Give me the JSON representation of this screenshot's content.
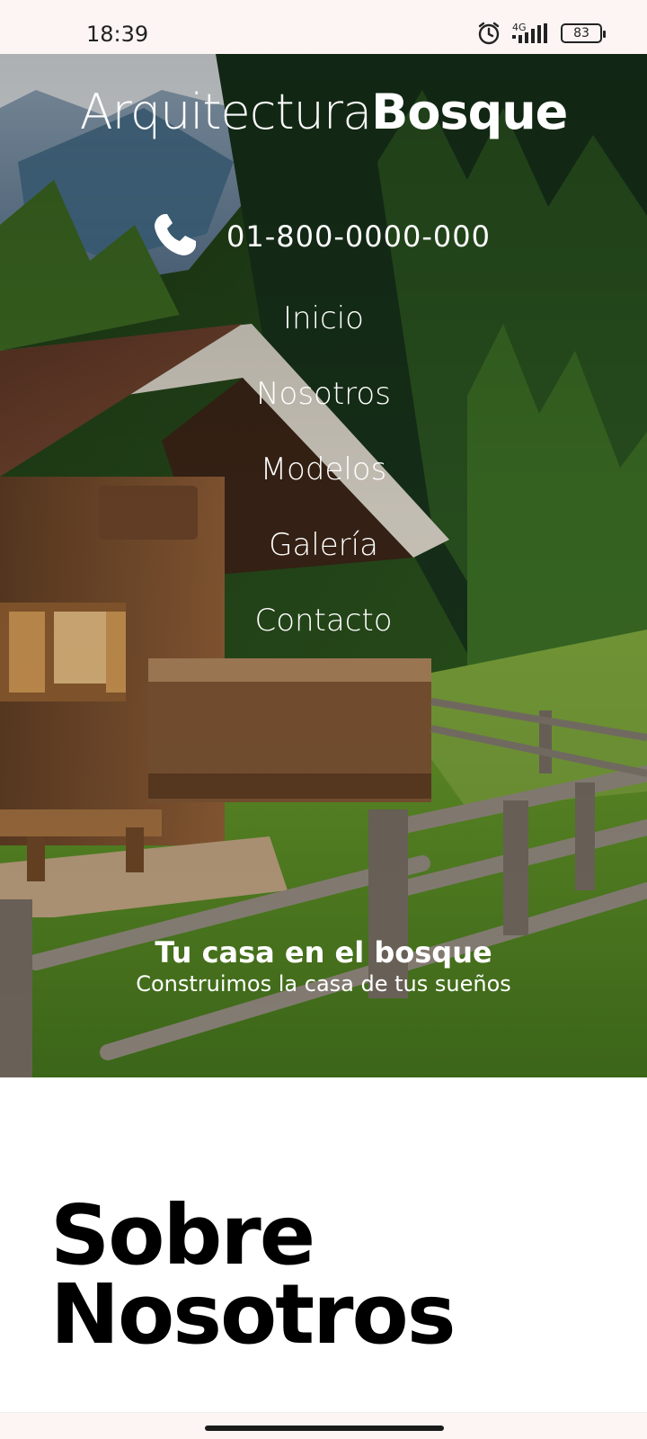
{
  "status_bar": {
    "time": "18:39",
    "network": "4G",
    "battery": "83",
    "icons": [
      "alarm-icon",
      "signal-icon",
      "battery-icon"
    ]
  },
  "header": {
    "brand_light": "Arquitectura",
    "brand_bold": "Bosque",
    "phone_icon": "phone-icon",
    "phone_number": "01-800-0000-000"
  },
  "nav": {
    "items": [
      {
        "label": "Inicio"
      },
      {
        "label": "Nosotros"
      },
      {
        "label": "Modelos"
      },
      {
        "label": "Galería"
      },
      {
        "label": "Contacto"
      }
    ]
  },
  "hero": {
    "title": "Tu casa en el bosque",
    "subtitle": "Construimos la casa de tus sueños"
  },
  "about": {
    "title_line1": "Sobre",
    "title_line2": "Nosotros"
  },
  "colors": {
    "status_bg": "#fdf5f3",
    "text_light": "#ffffff",
    "heading_dark": "#000000"
  }
}
